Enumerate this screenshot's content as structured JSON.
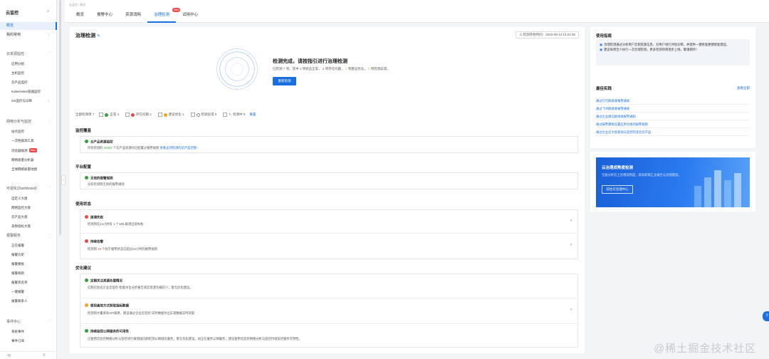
{
  "sidebar": {
    "title": "云监控",
    "items_top": [
      {
        "label": "概览"
      },
      {
        "label": "我的常用"
      }
    ],
    "groups": [
      {
        "label": "云资源监控",
        "items": [
          "应用分组",
          "主机监控",
          "云产品监控",
          "Kubernetes容器监控",
          "OS监控与诊断"
        ]
      },
      {
        "label": "网络分析与监控",
        "items": [
          "站点监控",
          "一次性拨测工具",
          "浏览器拨测",
          "网络质量分析器",
          "全球网络质量地图"
        ]
      },
      {
        "label": "可视化(Dashboard)",
        "items": [
          "自定义大盘",
          "网络监控大盘",
          "云产品大盘",
          "高频指标大盘"
        ]
      },
      {
        "label": "报警服务",
        "items": [
          "正在报警",
          "报警历史",
          "报警模板",
          "报警规则",
          "报警黑名单",
          "一键报警",
          "报警联系人"
        ]
      },
      {
        "label": "事件中心",
        "items": [
          "系统事件",
          "事件订阅"
        ]
      }
    ],
    "new_badge": "New"
  },
  "header": {
    "breadcrumb": "云监控 / 概览",
    "tabs": [
      {
        "label": "概览"
      },
      {
        "label": "报警中心"
      },
      {
        "label": "资源消耗"
      },
      {
        "label": "治理检测"
      },
      {
        "label": "试用中心"
      }
    ],
    "tab_badge": "New"
  },
  "main": {
    "title": "治理检测",
    "detect_time": "检测开始时间：2023-09-14 14:24:30",
    "result_title": "检测完成，请按指引进行治理检测",
    "result_sub": {
      "prefix": "已检测 7 项，其中",
      "normal": "4",
      "mid1": "项状态正常，",
      "issue": "2",
      "mid2": "项存在问题，",
      "suggest": "1",
      "mid3": "项建议优化，",
      "abnormal": "0",
      "suffix": "项检测异常。"
    },
    "redetect_btn": "重新检测",
    "filter": {
      "label": "全部检测项 7",
      "items": [
        {
          "label": "正常 4"
        },
        {
          "label": "存在问题 2"
        },
        {
          "label": "建议优化 1"
        },
        {
          "label": "检测异常 0"
        },
        {
          "label": "检测中 0"
        }
      ],
      "reset": "重置"
    },
    "sections": [
      {
        "title": "监控覆盖",
        "rows": [
          {
            "title": "云产品资源监控",
            "desc_prefix": "所有检测的",
            "desc_num": "10327",
            "desc_mid": "个云产品资源均已配置过报警规则",
            "desc_link": "查看支持检测的云产品范围",
            "status": "green"
          }
        ]
      },
      {
        "title": "平台配置",
        "rows": [
          {
            "title": "无效的报警规则",
            "desc": "没有检测到无效的报警规则",
            "status": "green"
          }
        ]
      },
      {
        "title": "使用状态",
        "rows": [
          {
            "title": "拨测失败",
            "desc": "检测到在24小时有 1 个URL拨测出现失败",
            "status": "red"
          },
          {
            "title": "持续告警",
            "desc_prefix": "检测到",
            "desc_num": "18",
            "desc_mid": "个处于报警状态已超过24小时的报警规则",
            "status": "red"
          }
        ]
      },
      {
        "title": "优化建议",
        "rows": [
          {
            "title": "定期关注资源负载情况",
            "desc": "近期已生成企业云监控-智能水位分析报告或云资源负载较少，暂无优化建议。",
            "status": "green"
          },
          {
            "title": "使用高效方式获取指标数据",
            "desc": "检测到大量查询API调用，建议通过企业云监控-实时数据导出实现数据实时获取",
            "status": "yellow"
          },
          {
            "title": "持续监控公网服务的可用性",
            "desc": "已使用云监控网络分析与监控进行拨测国内和检测公网域名服务，暂无优化建议。如正在服务公网服务，建议使用云监控网络分析与监控持续监控服务可用性。",
            "status": "green"
          }
        ]
      }
    ]
  },
  "guide": {
    "title": "使用指南",
    "tips": [
      "治理检测通过分析用户云侧资源信息、对用户进行评估诊断，并提供一键修复便捷修复建议。",
      "建议每周至少执行一次治理检测，更多检测项将逐步上线，敬请期待！"
    ],
    "best_title": "最佳实践",
    "best_more": "查看全部",
    "best_items": [
      "通过钉钉群接收报警通知",
      "通过飞书群接收报警通知",
      "通过企业微信群接收报警通知",
      "通过报警模板设置应用分组的报警规则",
      "通过企业云大盘查询与监控阿里云云产品"
    ]
  },
  "banner": {
    "title": "云治理成熟度检测",
    "sub": "全面分析云上治理成熟度，高效获取汇总报告与治理建议。",
    "btn": "前往云治理中心"
  },
  "watermark": "@稀土掘金技术社区",
  "colors": {
    "accent": "#1a6fe0",
    "ok": "#2aa43a",
    "error": "#e84a4a",
    "warn": "#e8a81f"
  }
}
